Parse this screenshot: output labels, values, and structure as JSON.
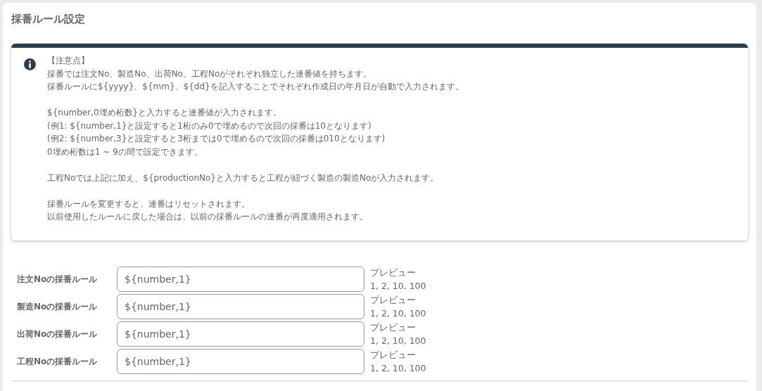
{
  "title": "採番ルール設定",
  "notice": {
    "paragraphs": [
      [
        "【注意点】",
        "採番では注文No、製造No、出荷No、工程Noがそれぞれ独立した連番値を持ちます。",
        "採番ルールに${yyyy}、${mm}、${dd}を記入することでそれぞれ作成日の年月日が自動で入力されます。"
      ],
      [
        "${number,0埋め桁数}と入力すると連番値が入力されます。",
        "(例1: ${number,1}と設定すると1桁のみ0で埋めるので次回の採番は10となります)",
        "(例2: ${number,3}と設定すると3桁までは0で埋めるので次回の採番は010となります)",
        "0埋め桁数は1 ~ 9の間で設定できます。"
      ],
      [
        "工程Noでは上記に加え、${productionNo}と入力すると工程が紐づく製造の製造Noが入力されます。"
      ],
      [
        "採番ルールを変更すると、連番はリセットされます。",
        "以前使用したルールに戻した場合は、以前の採番ルールの連番が再度適用されます。"
      ]
    ]
  },
  "rules": [
    {
      "label": "注文Noの採番ルール",
      "value": "${number,1}",
      "preview_label": "プレビュー",
      "preview": "1, 2, 10, 100"
    },
    {
      "label": "製造Noの採番ルール",
      "value": "${number,1}",
      "preview_label": "プレビュー",
      "preview": "1, 2, 10, 100"
    },
    {
      "label": "出荷Noの採番ルール",
      "value": "${number,1}",
      "preview_label": "プレビュー",
      "preview": "1, 2, 10, 100"
    },
    {
      "label": "工程Noの採番ルール",
      "value": "${number,1}",
      "preview_label": "プレビュー",
      "preview": "1, 2, 10, 100"
    }
  ]
}
